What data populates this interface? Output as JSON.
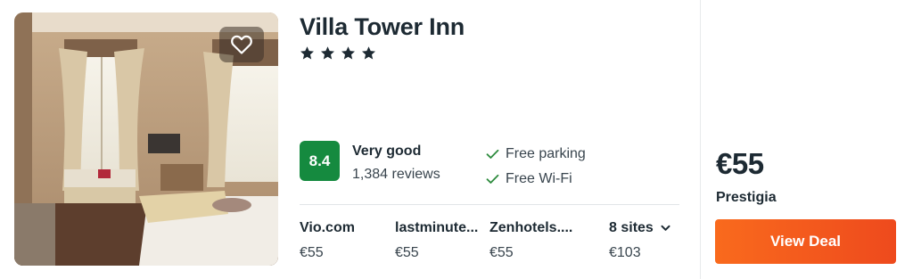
{
  "hotel": {
    "name": "Villa Tower Inn",
    "star_count": 4,
    "star_glyph": "★"
  },
  "rating": {
    "score": "8.4",
    "label": "Very good",
    "reviews": "1,384 reviews",
    "badge_color": "#158a3f"
  },
  "amenities": [
    {
      "label": "Free parking",
      "icon": "check-icon"
    },
    {
      "label": "Free Wi-Fi",
      "icon": "check-icon"
    }
  ],
  "sites": [
    {
      "name": "Vio.com",
      "price": "€55"
    },
    {
      "name": "lastminute...",
      "price": "€55"
    },
    {
      "name": "Zenhotels....",
      "price": "€55"
    }
  ],
  "more_sites": {
    "label": "8 sites",
    "price": "€103",
    "icon": "chevron-down-icon"
  },
  "deal": {
    "price": "€55",
    "provider": "Prestigia",
    "button_label": "View Deal",
    "button_color": "#f2561d"
  },
  "favorite": {
    "icon": "heart-icon"
  }
}
